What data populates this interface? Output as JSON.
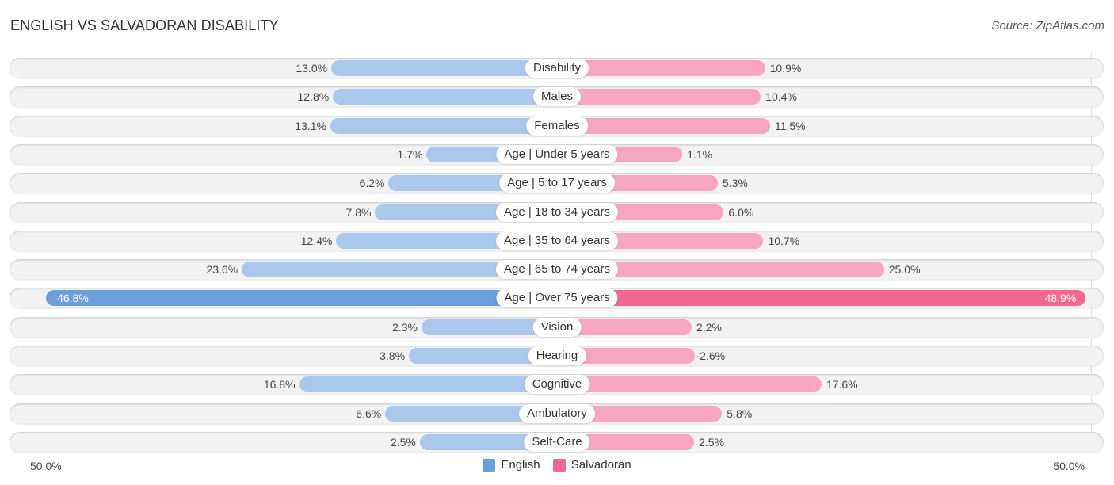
{
  "header": {
    "title": "ENGLISH VS SALVADORAN DISABILITY",
    "source": "Source: ZipAtlas.com"
  },
  "colors": {
    "english": "#6a9fda",
    "english_light": "#a9c8eb",
    "salvadoran": "#f06792",
    "salvadoran_light": "#f6a6c0",
    "row_bg": "#f2f2f2"
  },
  "chart_data": {
    "type": "bar",
    "orientation": "horizontal-diverging",
    "title": "ENGLISH VS SALVADORAN DISABILITY",
    "categories": [
      "Disability",
      "Males",
      "Females",
      "Age | Under 5 years",
      "Age | 5 to 17 years",
      "Age | 18 to 34 years",
      "Age | 35 to 64 years",
      "Age | 65 to 74 years",
      "Age | Over 75 years",
      "Vision",
      "Hearing",
      "Cognitive",
      "Ambulatory",
      "Self-Care"
    ],
    "series": [
      {
        "name": "English",
        "side": "left",
        "values": [
          13.0,
          12.8,
          13.1,
          1.7,
          6.2,
          7.8,
          12.4,
          23.6,
          46.8,
          2.3,
          3.8,
          16.8,
          6.6,
          2.5
        ]
      },
      {
        "name": "Salvadoran",
        "side": "right",
        "values": [
          10.9,
          10.4,
          11.5,
          1.1,
          5.3,
          6.0,
          10.7,
          25.0,
          48.9,
          2.2,
          2.6,
          17.6,
          5.8,
          2.5
        ]
      }
    ],
    "value_labels": {
      "English": [
        "13.0%",
        "12.8%",
        "13.1%",
        "1.7%",
        "6.2%",
        "7.8%",
        "12.4%",
        "23.6%",
        "46.8%",
        "2.3%",
        "3.8%",
        "16.8%",
        "6.6%",
        "2.5%"
      ],
      "Salvadoran": [
        "10.9%",
        "10.4%",
        "11.5%",
        "1.1%",
        "5.3%",
        "6.0%",
        "10.7%",
        "25.0%",
        "48.9%",
        "2.2%",
        "2.6%",
        "17.6%",
        "5.8%",
        "2.5%"
      ]
    },
    "axis": {
      "left_label": "50.0%",
      "right_label": "50.0%",
      "range": [
        0,
        50
      ]
    },
    "legend": {
      "position": "bottom-center",
      "entries": [
        "English",
        "Salvadoran"
      ]
    },
    "grid": false
  }
}
